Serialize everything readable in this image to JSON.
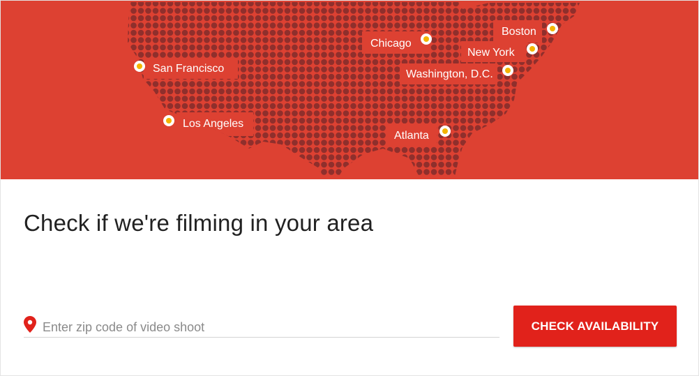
{
  "map": {
    "cities": [
      {
        "name": "San Francisco"
      },
      {
        "name": "Los Angeles"
      },
      {
        "name": "Chicago"
      },
      {
        "name": "Boston"
      },
      {
        "name": "New York"
      },
      {
        "name": "Washington, D.C."
      },
      {
        "name": "Atlanta"
      }
    ]
  },
  "heading": "Check if we're filming in your area",
  "zip": {
    "placeholder": "Enter zip code of video shoot",
    "value": ""
  },
  "button": {
    "label": "CHECK AVAILABILITY"
  },
  "colors": {
    "banner": "#dd4132",
    "dots": "#8f2f2c",
    "marker_fill": "#f4b400",
    "button": "#e1221b",
    "pin": "#e1221b"
  },
  "icons": [
    "location-pin-icon",
    "city-marker-icon"
  ]
}
